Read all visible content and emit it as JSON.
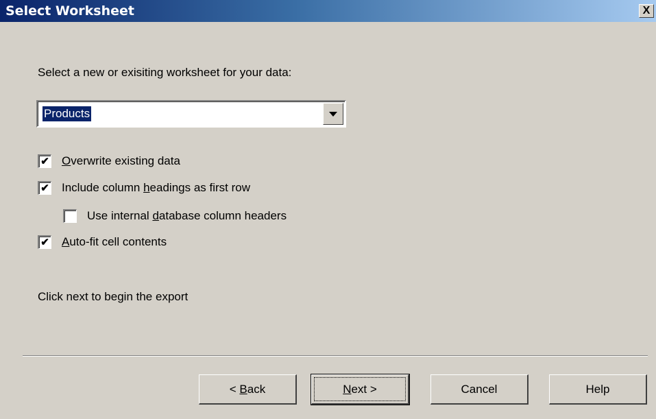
{
  "window": {
    "title": "Select Worksheet",
    "close_label": "X"
  },
  "prompt": "Select a new or exisiting worksheet for your data:",
  "worksheet_select": {
    "selected": "Products",
    "icon": "chevron-down-icon"
  },
  "options": {
    "overwrite": {
      "pre": "",
      "key": "O",
      "post": "verwrite existing data",
      "checked": true
    },
    "headings": {
      "pre": "Include column ",
      "key": "h",
      "post": "eadings as first row",
      "checked": true
    },
    "internal_headers": {
      "pre": "Use internal ",
      "key": "d",
      "post": "atabase column headers",
      "checked": false
    },
    "autofit": {
      "pre": "",
      "key": "A",
      "post": "uto-fit cell contents",
      "checked": true
    }
  },
  "hint": "Click next to begin the export",
  "buttons": {
    "back": {
      "pre": "< ",
      "key": "B",
      "post": "ack"
    },
    "next": {
      "pre": "",
      "key": "N",
      "post": "ext >"
    },
    "cancel": "Cancel",
    "help": "Help"
  },
  "check_mark": "✔"
}
